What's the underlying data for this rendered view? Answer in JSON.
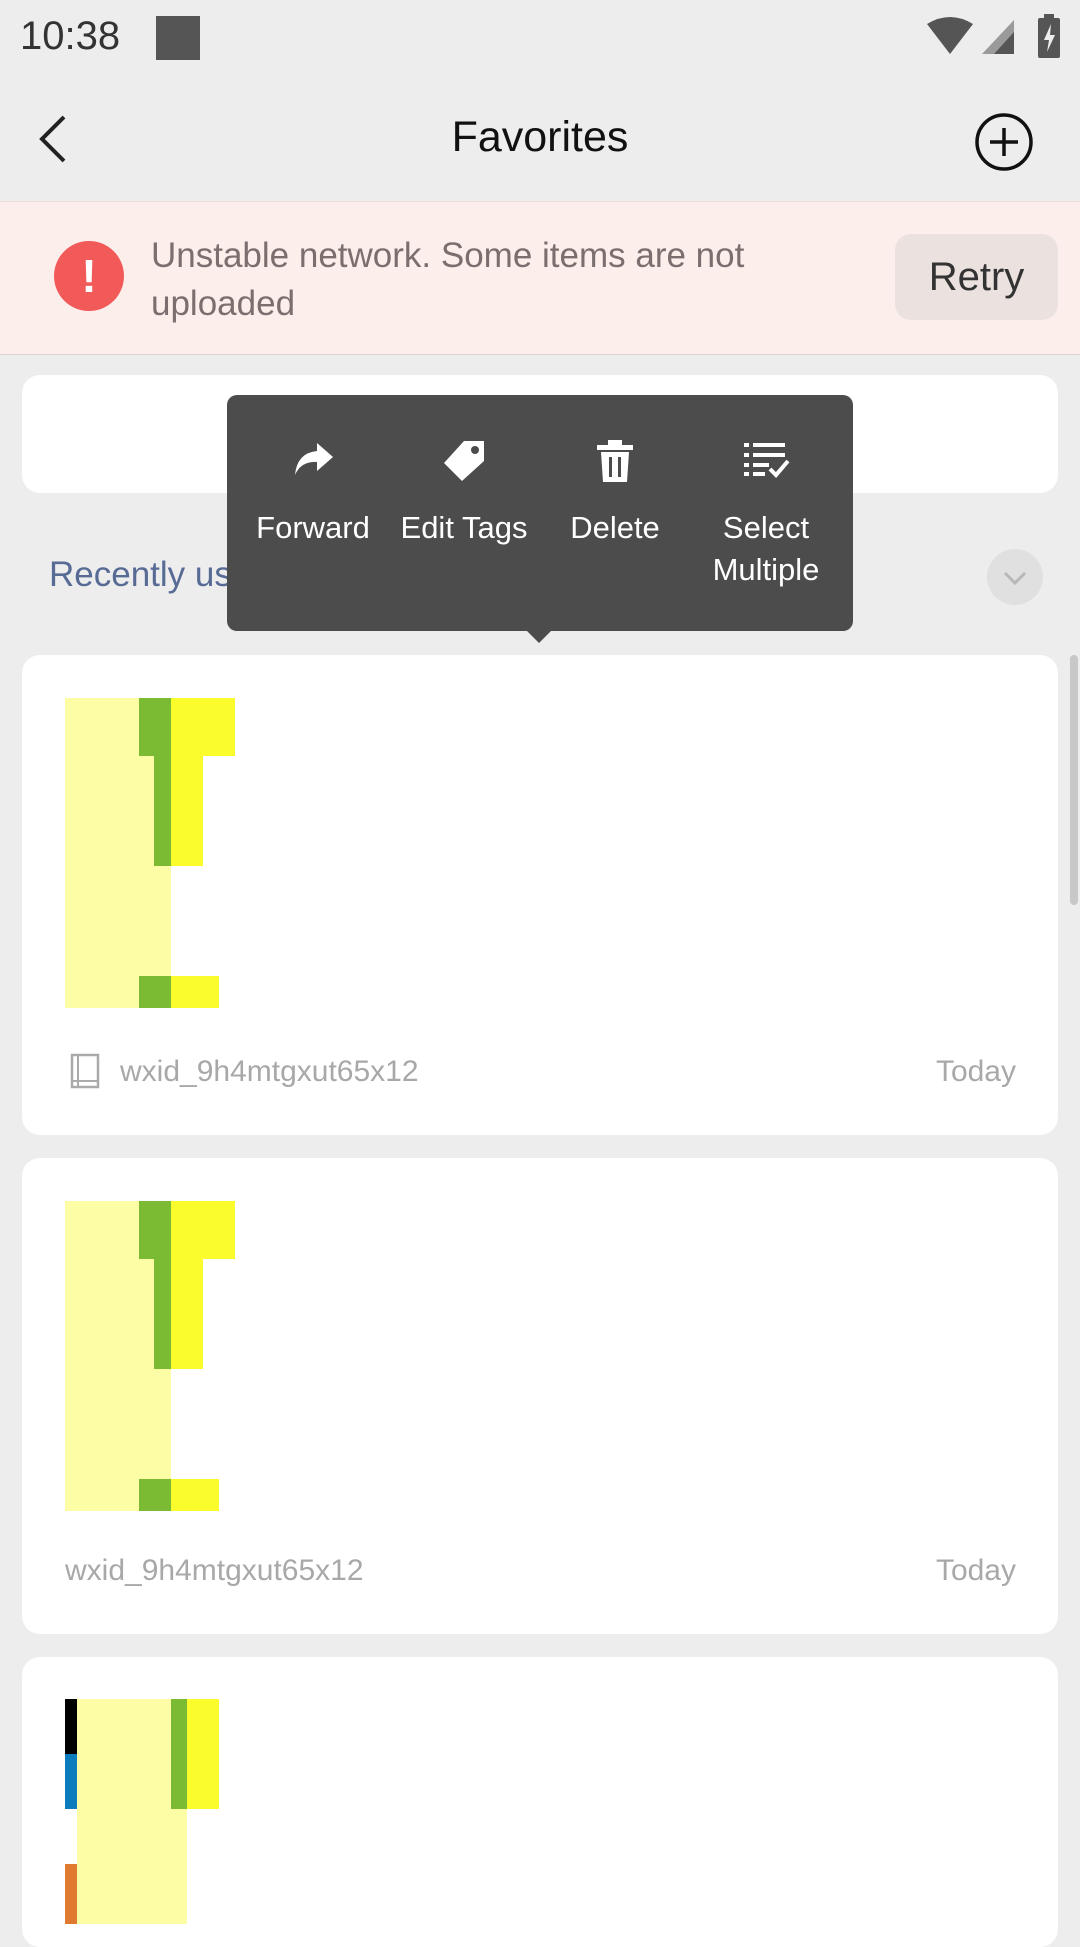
{
  "status_bar": {
    "time": "10:38"
  },
  "header": {
    "title": "Favorites"
  },
  "banner": {
    "message": "Unstable network. Some items are not uploaded",
    "retry_label": "Retry",
    "status_color": "#f25a5a"
  },
  "section": {
    "recent_label": "Recently us"
  },
  "context_menu": {
    "items": [
      {
        "label": "Forward",
        "icon": "forward-icon"
      },
      {
        "label": "Edit Tags",
        "icon": "tag-icon"
      },
      {
        "label": "Delete",
        "icon": "trash-icon"
      },
      {
        "label": "Select Multiple",
        "icon": "select-multiple-icon"
      }
    ]
  },
  "cards": [
    {
      "source": "wxid_9h4mtgxut65x12",
      "date": "Today",
      "icon": "note-icon"
    },
    {
      "source": "wxid_9h4mtgxut65x12",
      "date": "Today"
    },
    {
      "source": "",
      "date": ""
    }
  ],
  "colors": {
    "accent_link": "#576b95",
    "menu_bg": "#4c4c4c"
  }
}
